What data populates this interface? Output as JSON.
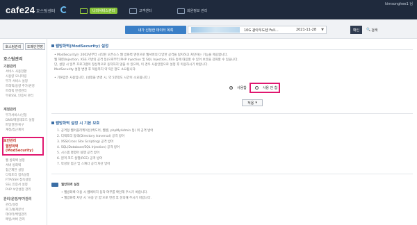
{
  "topbar": {
    "logo": "cafe24",
    "logo_sub": "호스팅센터",
    "user": "kimsonghee1 님",
    "tabs": [
      {
        "label": "나의서비스관리",
        "active": true
      },
      {
        "label": "고객센터",
        "active": false
      },
      {
        "label": "회원정보 관리",
        "active": false
      }
    ]
  },
  "service_select": {
    "label": "내가 신청한 데이터 목록",
    "domain": "10G 광아우도텐 Full...",
    "date": "2021-11-28",
    "confirm": "확인",
    "search": "검색"
  },
  "sidebar": {
    "btn_hosting": "호스팅관리",
    "btn_domain": "도메인연장",
    "group": "호스팅관리",
    "basic_title": "기본관리",
    "basic_items": [
      "서비스 사용현황",
      "사용량 모니터링",
      "부가 서비스 설정",
      "트래픽/용량 추가/변경",
      "트래픽 변경관리",
      "무료SSL 인증서 관리"
    ],
    "account_title": "계정관리",
    "account_items": [
      "부가서비스/신청",
      "DNS/메일레코드 설정",
      "파일권한/복구",
      "계정/접근제어"
    ],
    "security_title": "보안관리",
    "security_active": "웹방화벽",
    "security_active_sub": "(ModSecurity)",
    "security_items": [
      "웹 방화벽 설정",
      "서버 방화벽",
      "접근제한 설정",
      "디렉토리 접속설정",
      "FTP/SSH 접속설정",
      "SSL 인증서 설정",
      "PHP 보안설정 관리"
    ],
    "more_title": "관리/운영/부가관리",
    "more_items": [
      "관리/설정",
      "로그/통계분석",
      "데이터/백업관리",
      "메일/서버 관리",
      "환경설정"
    ]
  },
  "firewall": {
    "title": "웹방화벽(ModSecurity) 설정",
    "desc": [
      "• ModSecurity는 2002년부터 시작된 오픈소스 웹 방화벽 엔진으로 웹서버의 다양한 공격을 탐지하고 차단하는 기능을 제공합니다.",
      "  웹 해킹(Injection, XSS 기반의 공격 등)으로부터 PHP Injection 및 SQL Injection, XSS 등에 대응할 수 있어 보안을 강화할 수 있습니다.",
      "  단, 설정 시 일부 프로그램이 정상적으로 동작하지 않을 수 있으며, 이 경우 사용안함으로 설정 후 이용하시기 바랍니다.",
      "  ModSecurity 설정 변경 후 적용까지 약 5분 정도 소요됩니다.",
      "• 기본값은 사용입니다. (설정을 변경 시, 약 5분정도 시간이 소요됩니다.)"
    ],
    "opt_on": "사용함",
    "opt_off": "사용 안 함",
    "apply": "적용"
  },
  "rules": {
    "title": "웹방화벽 설정 시 기본 보호",
    "items": [
      "1. 공격형 웹어플리케이션(백도어, 웹셸, phpMyAdmin 등) 위 공격 방어",
      "2. 디렉토리 탐색(Directory traversal) 공격 방어",
      "3. XSS(Cross Site Scripting) 공격 방어",
      "4. SQL(Database/SQL Injection) 공격 방어",
      "5. 시스템 명령어 실행 공격 방어",
      "6. 원격 코드 실행(RCE) 공격 방어",
      "7. 악성봇 접근 및 스캐너 공격 차단 방어"
    ]
  },
  "notice": {
    "title": "웹방화벽 설정",
    "items": [
      "• 웹방화벽 이용 시 웹페이지 동작 여부를 확인해 주시기 바랍니다.",
      "• 웹방화벽 차단 시 '사용 안 함'으로 변경 후 문의해 주시기 바랍니다."
    ]
  }
}
